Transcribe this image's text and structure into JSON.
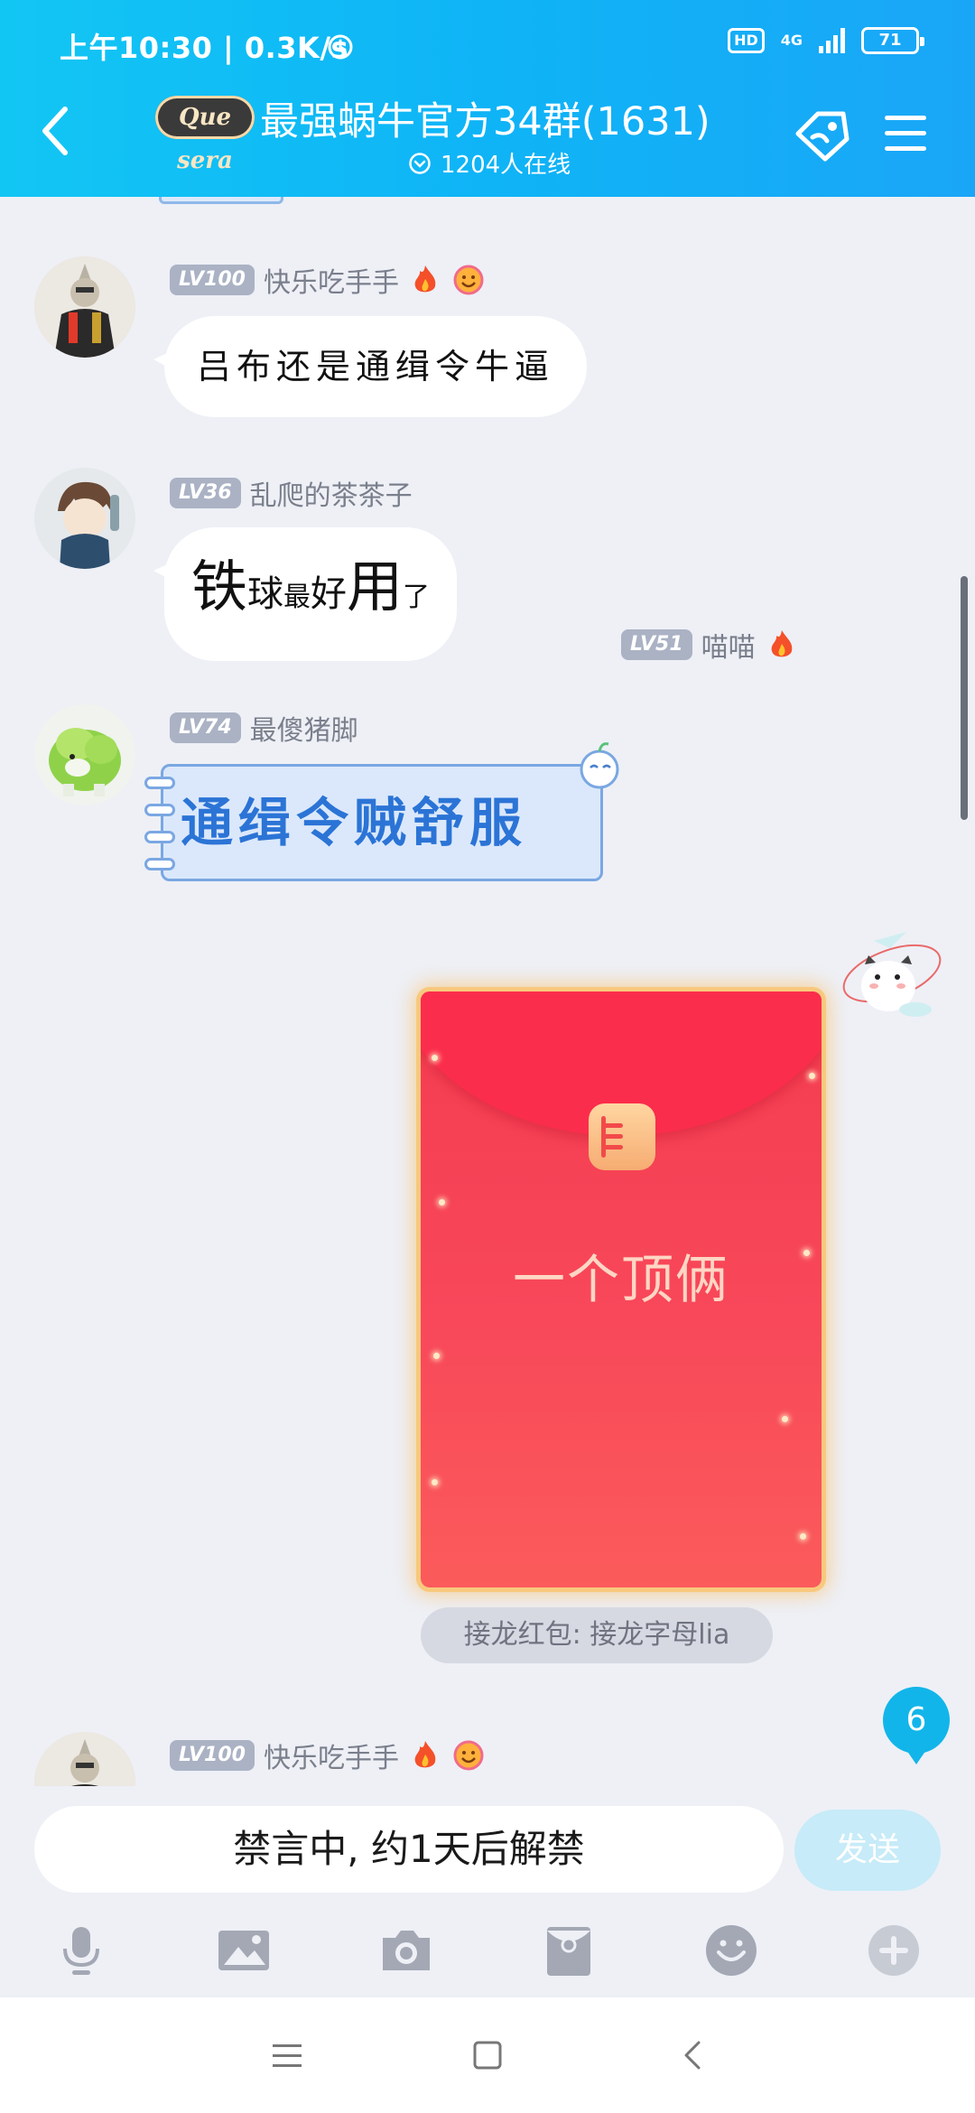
{
  "status_bar": {
    "left_text": "上午10:30 | 0.3K/s",
    "hd": "HD",
    "network": "4G",
    "battery": "71"
  },
  "header": {
    "logo_text": "Que sera",
    "title": "最强蜗牛官方34群(1631)",
    "online": "1204人在线"
  },
  "messages": [
    {
      "level": "LV100",
      "name": "快乐吃手手",
      "text": "吕布还是通缉令牛逼"
    },
    {
      "level": "LV36",
      "name": "乱爬的茶茶子",
      "parts": [
        "铁",
        "球",
        "最",
        "好",
        "用",
        "了"
      ]
    },
    {
      "level": "LV74",
      "name": "最傻猪脚",
      "text": "通缉令贼舒服"
    },
    {
      "level": "LV51",
      "name": "喵喵",
      "red_packet_text": "一个顶俩",
      "caption": "接龙红包: 接龙字母lia"
    },
    {
      "level": "LV100",
      "name": "快乐吃手手"
    }
  ],
  "unread_count": "6",
  "input": {
    "muted_text": "禁言中, 约1天后解禁",
    "send_label": "发送"
  },
  "toolbar_icons": [
    "mic-icon",
    "image-icon",
    "camera-icon",
    "red-packet-icon",
    "emoji-icon",
    "plus-icon"
  ],
  "colors": {
    "header_start": "#12c6f4",
    "header_end": "#1aa6f7",
    "accent": "#12b5ea",
    "red_packet": "#f43b4f"
  }
}
